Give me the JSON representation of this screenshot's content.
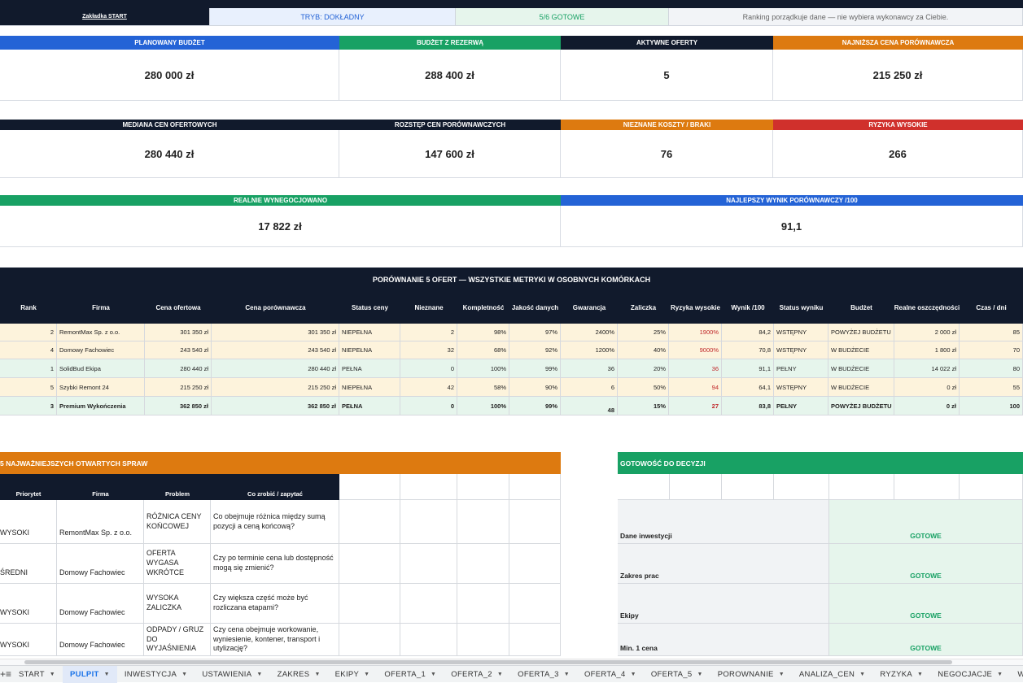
{
  "status": {
    "start_tab": "Zakładka START",
    "mode": "TRYB: DOKŁADNY",
    "ready": "5/6 GOTOWE",
    "note": "Ranking porządkuje dane — nie wybiera wykonawcy za Ciebie."
  },
  "kpi1": [
    {
      "label": "PLANOWANY BUDŻET",
      "value": "280 000 zł"
    },
    {
      "label": "BUDŻET Z REZERWĄ",
      "value": "288 400 zł"
    },
    {
      "label": "AKTYWNE OFERTY",
      "value": "5"
    },
    {
      "label": "NAJNIŻSZA CENA PORÓWNAWCZA",
      "value": "215 250 zł"
    }
  ],
  "kpi2": [
    {
      "label": "MEDIANA CEN OFERTOWYCH",
      "value": "280 440 zł"
    },
    {
      "label": "ROZSTĘP CEN PORÓWNAWCZYCH",
      "value": "147 600 zł"
    },
    {
      "label": "NIEZNANE KOSZTY / BRAKI",
      "value": "76"
    },
    {
      "label": "RYZYKA WYSOKIE",
      "value": "266"
    }
  ],
  "kpi3": [
    {
      "label": "REALNIE WYNEGOCJOWANO",
      "value": "17 822 zł"
    },
    {
      "label": "NAJLEPSZY WYNIK PORÓWNAWCZY /100",
      "value": "91,1"
    }
  ],
  "compare": {
    "title": "PORÓWNANIE 5 OFERT — WSZYSTKIE METRYKI W OSOBNYCH KOMÓRKACH",
    "headers": [
      "Rank",
      "Firma",
      "Cena ofertowa",
      "Cena porównawcza",
      "Status ceny",
      "Nieznane",
      "Kompletność",
      "Jakość danych",
      "Gwarancja",
      "Zaliczka",
      "Ryzyka wysokie",
      "Wynik /100",
      "Status wyniku",
      "Budżet",
      "Realne oszczędności",
      "Czas / dni"
    ],
    "rows": [
      [
        "2",
        "RemontMax Sp. z o.o.",
        "301 350 zł",
        "301 350 zł",
        "NIEPEŁNA",
        "2",
        "98%",
        "97%",
        "2400%",
        "25%",
        "1900%",
        "84,2",
        "WSTĘPNY",
        "POWYŻEJ BUDŻETU",
        "2 000 zł",
        "85"
      ],
      [
        "4",
        "Domowy Fachowiec",
        "243 540 zł",
        "243 540 zł",
        "NIEPEŁNA",
        "32",
        "68%",
        "92%",
        "1200%",
        "40%",
        "9000%",
        "70,8",
        "WSTĘPNY",
        "W BUDŻECIE",
        "1 800 zł",
        "70"
      ],
      [
        "1",
        "SolidBud Ekipa",
        "280 440 zł",
        "280 440 zł",
        "PEŁNA",
        "0",
        "100%",
        "99%",
        "36",
        "20%",
        "36",
        "91,1",
        "PEŁNY",
        "W BUDŻECIE",
        "14 022 zł",
        "80"
      ],
      [
        "5",
        "Szybki Remont 24",
        "215 250 zł",
        "215 250 zł",
        "NIEPEŁNA",
        "42",
        "58%",
        "90%",
        "6",
        "50%",
        "94",
        "64,1",
        "WSTĘPNY",
        "W BUDŻECIE",
        "0 zł",
        "55"
      ],
      [
        "3",
        "Premium Wykończenia",
        "362 850 zł",
        "362 850 zł",
        "PEŁNA",
        "0",
        "100%",
        "99%",
        "48",
        "15%",
        "27",
        "83,8",
        "PEŁNY",
        "POWYŻEJ BUDŻETU",
        "0 zł",
        "100"
      ]
    ]
  },
  "issues": {
    "title": "5 NAJWAŻNIEJSZYCH OTWARTYCH SPRAW",
    "headers": [
      "Priorytet",
      "Firma",
      "Problem",
      "Co zrobić / zapytać"
    ],
    "rows": [
      [
        "WYSOKI",
        "RemontMax Sp. z o.o.",
        "RÓŻNICA CENY KOŃCOWEJ",
        "Co obejmuje różnica między sumą pozycji a ceną końcową?"
      ],
      [
        "ŚREDNI",
        "Domowy Fachowiec",
        "OFERTA WYGASA WKRÓTCE",
        "Czy po terminie cena lub dostępność mogą się zmienić?"
      ],
      [
        "WYSOKI",
        "Domowy Fachowiec",
        "WYSOKA ZALICZKA",
        "Czy większa część może być rozliczana etapami?"
      ],
      [
        "WYSOKI",
        "Domowy Fachowiec",
        "ODPADY / GRUZ DO WYJAŚNIENIA",
        "Czy cena obejmuje workowanie, wyniesienie, kontener, transport i utylizację?"
      ]
    ]
  },
  "readiness": {
    "title": "GOTOWOŚĆ DO DECYZJI",
    "rows": [
      [
        "Dane inwestycji",
        "GOTOWE"
      ],
      [
        "Zakres prac",
        "GOTOWE"
      ],
      [
        "Ekipy",
        "GOTOWE"
      ],
      [
        "Min. 1 cena",
        "GOTOWE"
      ]
    ]
  },
  "tabs": [
    "START",
    "PULPIT",
    "INWESTYCJA",
    "USTAWIENIA",
    "ZAKRES",
    "EKIPY",
    "OFERTA_1",
    "OFERTA_2",
    "OFERTA_3",
    "OFERTA_4",
    "OFERTA_5",
    "POROWNANIE",
    "ANALIZA_CEN",
    "RYZYKA",
    "NEGOCJACJE",
    "WERD"
  ],
  "active_tab": "PULPIT",
  "colors": {
    "navy": "#111a2c",
    "blue": "#2463d6",
    "green": "#18a164",
    "orange": "#dd7a10",
    "red": "#d0302c"
  }
}
